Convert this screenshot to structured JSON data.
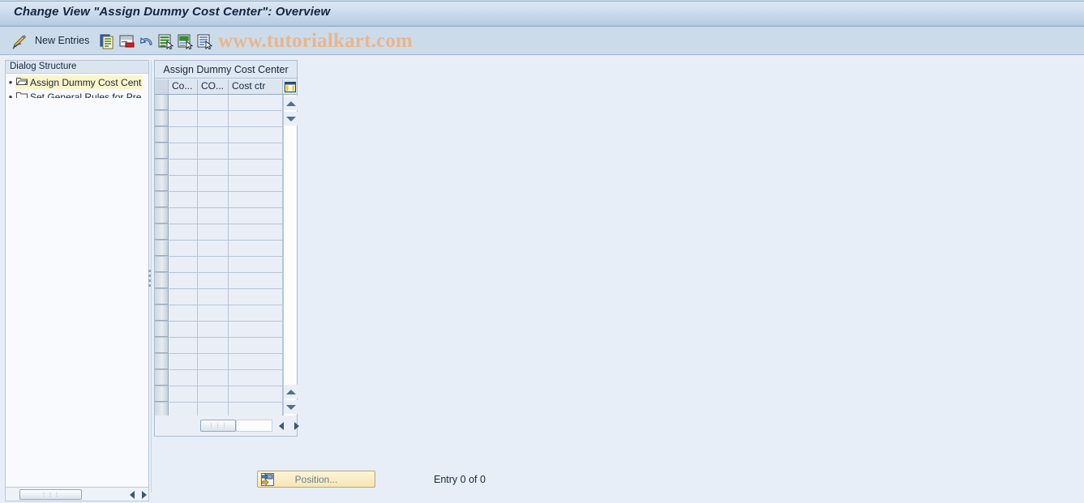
{
  "window": {
    "title": "Change View \"Assign Dummy Cost Center\": Overview"
  },
  "toolbar": {
    "pencil_icon": "pencil-display-change-icon",
    "new_entries_label": "New Entries",
    "buttons": [
      {
        "name": "copy-as-icon",
        "title": "Copy As..."
      },
      {
        "name": "delete-icon",
        "title": "Delete"
      },
      {
        "name": "undo-icon",
        "title": "Undo Change"
      },
      {
        "name": "select-all-icon",
        "title": "Select All"
      },
      {
        "name": "select-block-icon",
        "title": "Select Block"
      },
      {
        "name": "deselect-all-icon",
        "title": "Deselect All"
      }
    ],
    "watermark": "www.tutorialkart.com"
  },
  "sidebar": {
    "header": "Dialog Structure",
    "items": [
      {
        "label": "Assign Dummy Cost Cent",
        "icon": "folder-open-icon",
        "selected": true
      },
      {
        "label": "Set General Rules for Pre",
        "icon": "folder-closed-icon",
        "selected": false
      }
    ]
  },
  "table": {
    "title": "Assign Dummy Cost Center",
    "columns": [
      {
        "key": "sel",
        "label": ""
      },
      {
        "key": "co1",
        "label": "Co..."
      },
      {
        "key": "co2",
        "label": "CO..."
      },
      {
        "key": "cctr",
        "label": "Cost ctr"
      }
    ],
    "config_icon": "column-configuration-icon",
    "rows": [],
    "empty_row_count": 20
  },
  "footer": {
    "position_button": "Position...",
    "position_icon": "position-jump-icon",
    "entry_count": "Entry 0 of 0"
  },
  "scrollbars": {
    "left_grip": "⋯",
    "table_grip": "⋯",
    "arrow_left_icon": "arrow-left-icon",
    "arrow_right_icon": "arrow-right-icon",
    "arrow_up_icon": "arrow-up-icon",
    "arrow_down_icon": "arrow-down-icon"
  },
  "colors": {
    "title_accent": "#b8cde3",
    "toolbar_bg": "#ccdbe9",
    "canvas_bg": "#e8eef7",
    "selection_highlight": "#fcf5ca",
    "watermark": "#eab58d",
    "button_yellow": "#f6e6b4"
  }
}
